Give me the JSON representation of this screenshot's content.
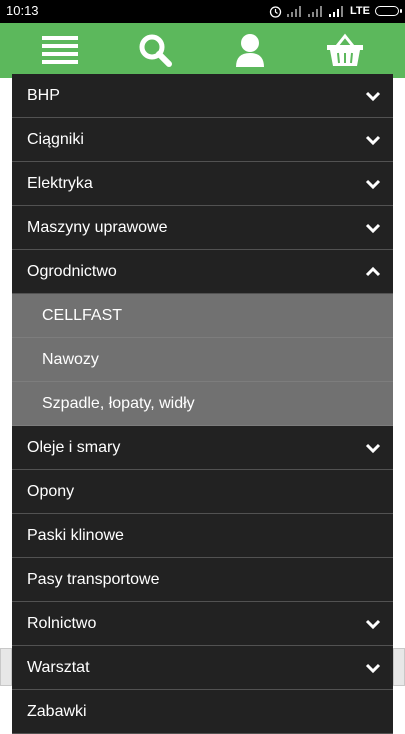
{
  "status_bar": {
    "time": "10:13",
    "network": "LTE"
  },
  "header": {
    "icons": [
      "menu-icon",
      "search-icon",
      "user-icon",
      "basket-icon"
    ],
    "background": "#5cb85c"
  },
  "menu": {
    "items": [
      {
        "label": "BHP",
        "chevron": "down"
      },
      {
        "label": "Ciągniki",
        "chevron": "down"
      },
      {
        "label": "Elektryka",
        "chevron": "down"
      },
      {
        "label": "Maszyny uprawowe",
        "chevron": "down"
      },
      {
        "label": "Ogrodnictwo",
        "chevron": "up"
      },
      {
        "label": "Oleje i smary",
        "chevron": "down"
      },
      {
        "label": "Opony",
        "chevron": ""
      },
      {
        "label": "Paski klinowe",
        "chevron": ""
      },
      {
        "label": "Pasy transportowe",
        "chevron": ""
      },
      {
        "label": "Rolnictwo",
        "chevron": "down"
      },
      {
        "label": "Warsztat",
        "chevron": "down"
      },
      {
        "label": "Zabawki",
        "chevron": ""
      }
    ],
    "expanded_submenu": [
      "CELLFAST",
      "Nawozy",
      "Szpadle, łopaty, widły"
    ]
  }
}
